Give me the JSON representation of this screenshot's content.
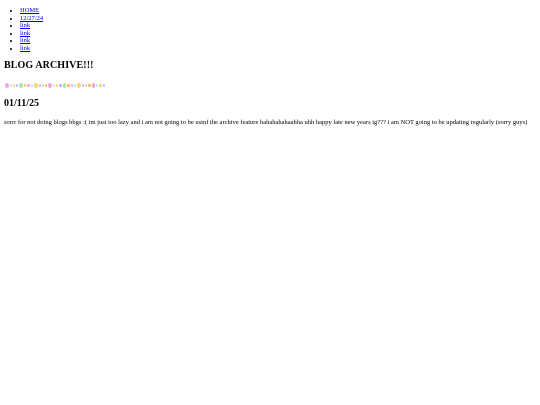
{
  "nav": {
    "items": [
      {
        "label": "HOME"
      },
      {
        "label": "12/27/24"
      },
      {
        "label": "link"
      },
      {
        "label": "link"
      },
      {
        "label": "link"
      },
      {
        "label": "link"
      }
    ]
  },
  "page": {
    "title": "BLOG ARCHIVE!!!"
  },
  "divider": {
    "colors": [
      "#f2a7d8",
      "#b7e3ff",
      "#f7d36b",
      "#d4a8ff",
      "#a8e6a1",
      "#ffb36b"
    ]
  },
  "post": {
    "date": "01/11/25",
    "text": "sorrr for not doing blogs bbgs :( im just too lazy and i am not going to be usinf the archive feature hahahahahaahha uhh happy late new years ig??? i am NOT going to be updating regularly (sorry guys)"
  }
}
